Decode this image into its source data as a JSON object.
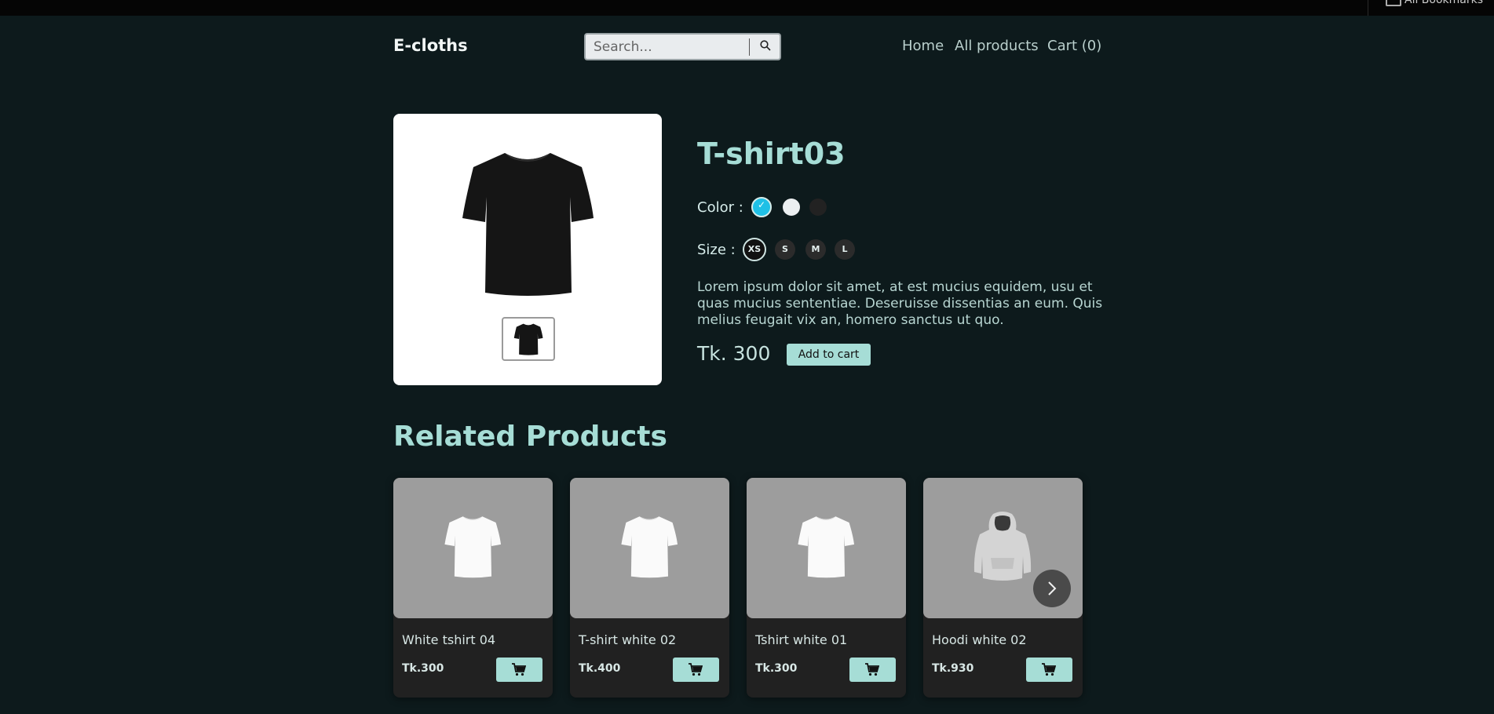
{
  "browser": {
    "bookmark_label": "All Bookmarks"
  },
  "header": {
    "brand": "E-cloths",
    "search_placeholder": "Search...",
    "nav": {
      "home": "Home",
      "all_products": "All products",
      "cart": "Cart (0)"
    }
  },
  "product": {
    "title": "T-shirt03",
    "color_label": "Color :",
    "colors": [
      "#1fc0e6",
      "#eceff1",
      "#222222"
    ],
    "selected_color_mark": "✓",
    "size_label": "Size :",
    "sizes": [
      "XS",
      "S",
      "M",
      "L"
    ],
    "selected_size": "XS",
    "description": "Lorem ipsum dolor sit amet, at est mucius equidem, usu et quas mucius sententiae. Deseruisse dissentias an eum. Quis melius feugait vix an, homero sanctus ut quo.",
    "price": "Tk. 300",
    "add_to_cart": "Add to cart"
  },
  "related": {
    "title": "Related Products",
    "items": [
      {
        "name": "White tshirt 04",
        "price": "Tk.300",
        "icon": "tshirt-icon"
      },
      {
        "name": "T-shirt white 02",
        "price": "Tk.400",
        "icon": "tshirt-icon"
      },
      {
        "name": "Tshirt white 01",
        "price": "Tk.300",
        "icon": "tshirt-icon"
      },
      {
        "name": "Hoodi white 02",
        "price": "Tk.930",
        "icon": "hoodie-icon"
      }
    ]
  },
  "colors": {
    "background": "#0d1a1c",
    "accent": "#a6ddd6",
    "card": "#212121"
  }
}
